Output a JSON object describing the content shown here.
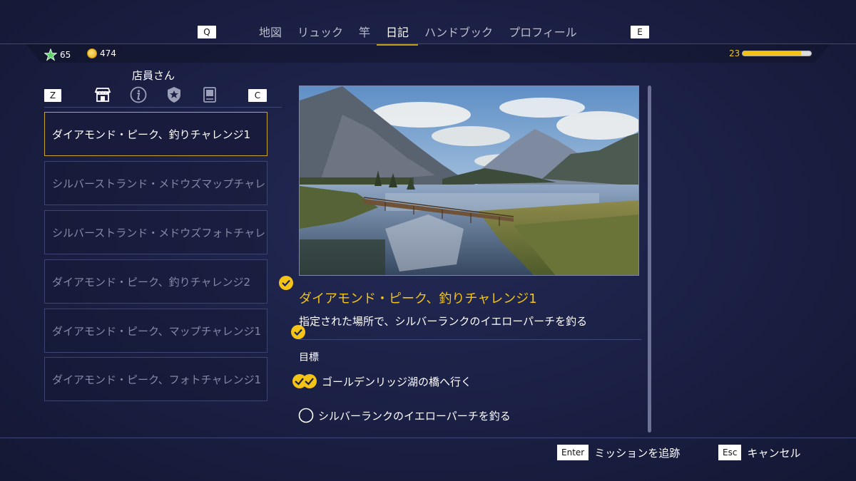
{
  "nav": {
    "left_key": "Q",
    "right_key": "E",
    "tabs": [
      {
        "label": "地図"
      },
      {
        "label": "リュック"
      },
      {
        "label": "竿"
      },
      {
        "label": "日記"
      },
      {
        "label": "ハンドブック"
      },
      {
        "label": "プロフィール"
      }
    ],
    "active_tab": "日記"
  },
  "status": {
    "stars": "65",
    "coins": "474",
    "level": "23",
    "xp_progress": 0.85
  },
  "shop": {
    "title": "店員さん",
    "left_key": "Z",
    "right_key": "C",
    "icons": [
      "shop-icon",
      "info-icon",
      "badge-icon",
      "book-icon"
    ]
  },
  "quests": [
    {
      "label": "ダイアモンド・ピーク、釣りチャレンジ1",
      "completed": false,
      "selected": true
    },
    {
      "label": "シルバーストランド・メドウズマップチャレンジ",
      "completed": false,
      "selected": false
    },
    {
      "label": "シルバーストランド・メドウズフォトチャレンジ",
      "completed": false,
      "selected": false
    },
    {
      "label": "ダイアモンド・ピーク、釣りチャレンジ2",
      "completed": true,
      "selected": false
    },
    {
      "label": "ダイアモンド・ピーク、マップチャレンジ1",
      "completed": true,
      "selected": false
    },
    {
      "label": "ダイアモンド・ピーク、フォトチャレンジ1",
      "completed": false,
      "selected": false
    }
  ],
  "detail": {
    "title": "ダイアモンド・ピーク、釣りチャレンジ1",
    "description": "指定された場所で、シルバーランクのイエローパーチを釣る",
    "objectives_label": "目標",
    "objectives": [
      {
        "label": "ゴールデンリッジ湖の橋へ行く",
        "status": "complete"
      },
      {
        "label": "シルバーランクのイエローパーチを釣る",
        "status": "incomplete"
      }
    ]
  },
  "footer": {
    "track": {
      "key": "Enter",
      "label": "ミッションを追跡"
    },
    "cancel": {
      "key": "Esc",
      "label": "キャンセル"
    }
  },
  "colors": {
    "accent": "#f3c316",
    "background": "#1c2147",
    "inactive_text": "#838aa6"
  }
}
